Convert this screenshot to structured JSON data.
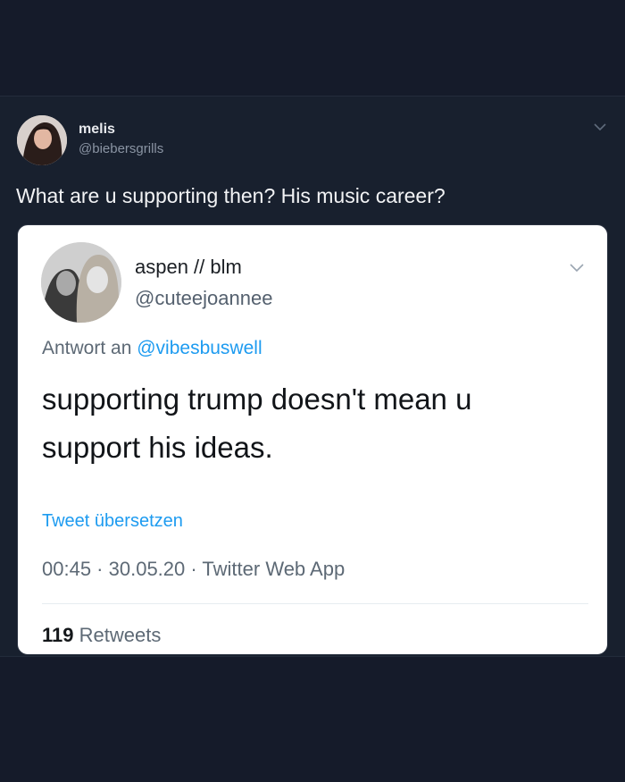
{
  "outer_tweet": {
    "display_name": "melis",
    "handle": "@biebersgrills",
    "text": "What are u supporting then? His music career?"
  },
  "quoted_tweet": {
    "display_name": "aspen // blm",
    "handle": "@cuteejoannee",
    "reply_prefix": "Antwort an",
    "reply_mention": "@vibesbuswell",
    "body_line1": "supporting trump doesn't mean u",
    "body_line2": "support his ideas.",
    "translate_link": "Tweet übersetzen",
    "time": "00:45",
    "date": "30.05.20",
    "source": "Twitter Web App",
    "retweet_count": "119",
    "retweet_label": "Retweets"
  },
  "icons": {
    "outer_menu": "chevron-down-icon",
    "quoted_menu": "chevron-down-icon"
  },
  "colors": {
    "background": "#151b2a",
    "link_blue": "#1d9bf0",
    "card_background": "#ffffff"
  }
}
